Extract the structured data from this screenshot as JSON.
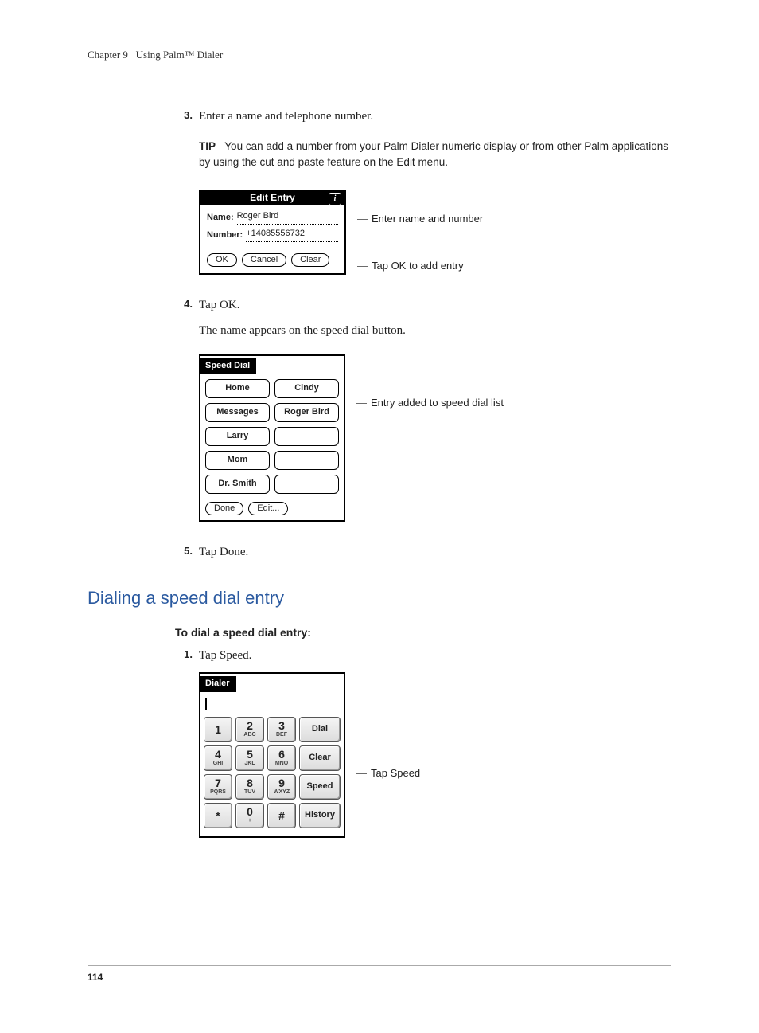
{
  "header": {
    "chapter_label": "Chapter 9",
    "chapter_title": "Using Palm™ Dialer"
  },
  "steps": {
    "s3": {
      "num": "3.",
      "text": "Enter a name and telephone number."
    },
    "s4": {
      "num": "4.",
      "text": "Tap OK.",
      "followup": "The name appears on the speed dial button."
    },
    "s5": {
      "num": "5.",
      "text": "Tap Done."
    },
    "d1": {
      "num": "1.",
      "text": "Tap Speed."
    }
  },
  "tip": {
    "label": "TIP",
    "text": "You can add a number from your Palm Dialer numeric display or from other Palm applications by using the cut and paste feature on the Edit menu."
  },
  "section": {
    "heading": "Dialing a speed dial entry",
    "subheading": "To dial a speed dial entry:"
  },
  "edit_entry": {
    "title": "Edit Entry",
    "name_label": "Name:",
    "name_value": "Roger Bird",
    "number_label": "Number:",
    "number_value": "+14085556732",
    "ok": "OK",
    "cancel": "Cancel",
    "clear": "Clear",
    "callout_fields": "Enter name and number",
    "callout_ok": "Tap OK to add entry"
  },
  "speed_dial": {
    "tab": "Speed Dial",
    "rows": [
      [
        "Home",
        "Cindy"
      ],
      [
        "Messages",
        "Roger Bird"
      ],
      [
        "Larry",
        ""
      ],
      [
        "Mom",
        ""
      ],
      [
        "Dr. Smith",
        ""
      ]
    ],
    "done": "Done",
    "edit": "Edit...",
    "callout": "Entry added to speed dial list"
  },
  "dialer": {
    "tab": "Dialer",
    "keys": [
      [
        {
          "n": "1",
          "l": ""
        },
        {
          "n": "2",
          "l": "ABC"
        },
        {
          "n": "3",
          "l": "DEF"
        }
      ],
      [
        {
          "n": "4",
          "l": "GHI"
        },
        {
          "n": "5",
          "l": "JKL"
        },
        {
          "n": "6",
          "l": "MNO"
        }
      ],
      [
        {
          "n": "7",
          "l": "PQRS"
        },
        {
          "n": "8",
          "l": "TUV"
        },
        {
          "n": "9",
          "l": "WXYZ"
        }
      ],
      [
        {
          "n": "*",
          "l": ""
        },
        {
          "n": "0",
          "l": "+"
        },
        {
          "n": "#",
          "l": ""
        }
      ]
    ],
    "side": [
      "Dial",
      "Clear",
      "Speed",
      "History"
    ],
    "callout": "Tap Speed"
  },
  "page_number": "114"
}
